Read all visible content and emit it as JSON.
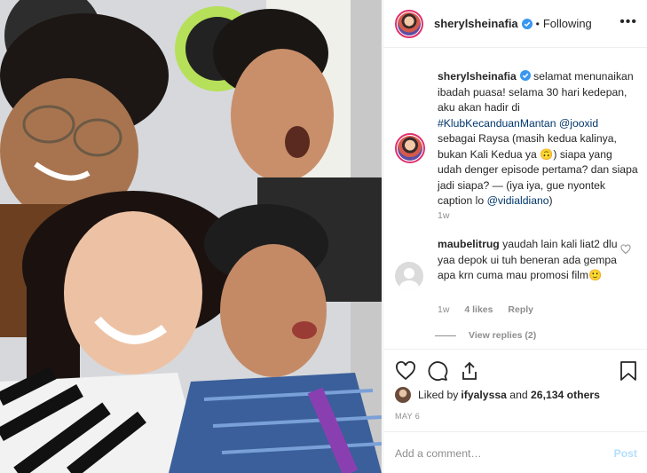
{
  "post": {
    "username": "sherylsheinafia",
    "follow_state": "Following",
    "separator": "•",
    "more_label": "•••"
  },
  "caption": {
    "username": "sherylsheinafia",
    "text_1": " selamat menunaikan ibadah puasa! selama 30 hari kedepan, aku akan hadir di ",
    "hashtag": "#KlubKecanduanMantan",
    "space": " ",
    "mention_1": "@jooxid",
    "text_2": " sebagai Raysa (masih kedua kalinya, bukan Kali Kedua ya ",
    "emoji": "🙃",
    "text_3": ") siapa yang udah denger episode pertama? dan siapa jadi siapa? — (iya iya, gue nyontek caption lo ",
    "mention_2": "@vidialdiano",
    "text_4": ")",
    "time": "1w"
  },
  "comment": {
    "username": "maubelitrug",
    "text": " yaudah lain kali liat2 dlu yaa depok ui tuh beneran ada gempa apa krn cuma mau promosi film",
    "emoji": "🙂",
    "time": "1w",
    "likes": "4 likes",
    "reply": "Reply",
    "view_replies": "View replies (2)"
  },
  "likes": {
    "prefix": "Liked by ",
    "user": "ifyalyssa",
    "middle": " and ",
    "count": "26,134 others"
  },
  "date": "MAY 6",
  "add_comment": {
    "placeholder": "Add a comment…",
    "post_label": "Post"
  },
  "colors": {
    "link": "#00376b",
    "verified": "#3897f0",
    "muted": "#8e8e8e",
    "post_disabled": "#b2dffc"
  },
  "icons": [
    "verified-icon",
    "more-icon",
    "heart-icon",
    "comment-icon",
    "share-icon",
    "bookmark-icon",
    "small-heart-icon",
    "default-avatar-icon"
  ]
}
